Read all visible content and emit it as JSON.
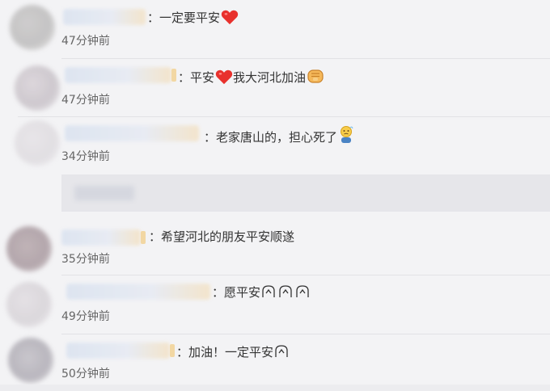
{
  "comments": [
    {
      "text": "：一定要平安",
      "time": "47分钟前"
    },
    {
      "text_prefix": "：平安",
      "text_suffix": "我大河北加油",
      "time": "47分钟前"
    },
    {
      "text": "：老家唐山的，担心死了",
      "time": "34分钟前"
    },
    {
      "text": "：希望河北的朋友平安顺遂",
      "time": "35分钟前"
    },
    {
      "text": "：愿平安",
      "time": "49分钟前"
    },
    {
      "text": "：加油！一定平安",
      "time": "50分钟前"
    }
  ],
  "icons": {
    "heart": "heart-icon",
    "fist": "fist-icon",
    "worried": "worried-face-icon",
    "praying": "praying-icon"
  },
  "colors": {
    "background": "#f3f3f5",
    "heart": "#e8312d",
    "text": "#333333",
    "time": "#666666"
  }
}
